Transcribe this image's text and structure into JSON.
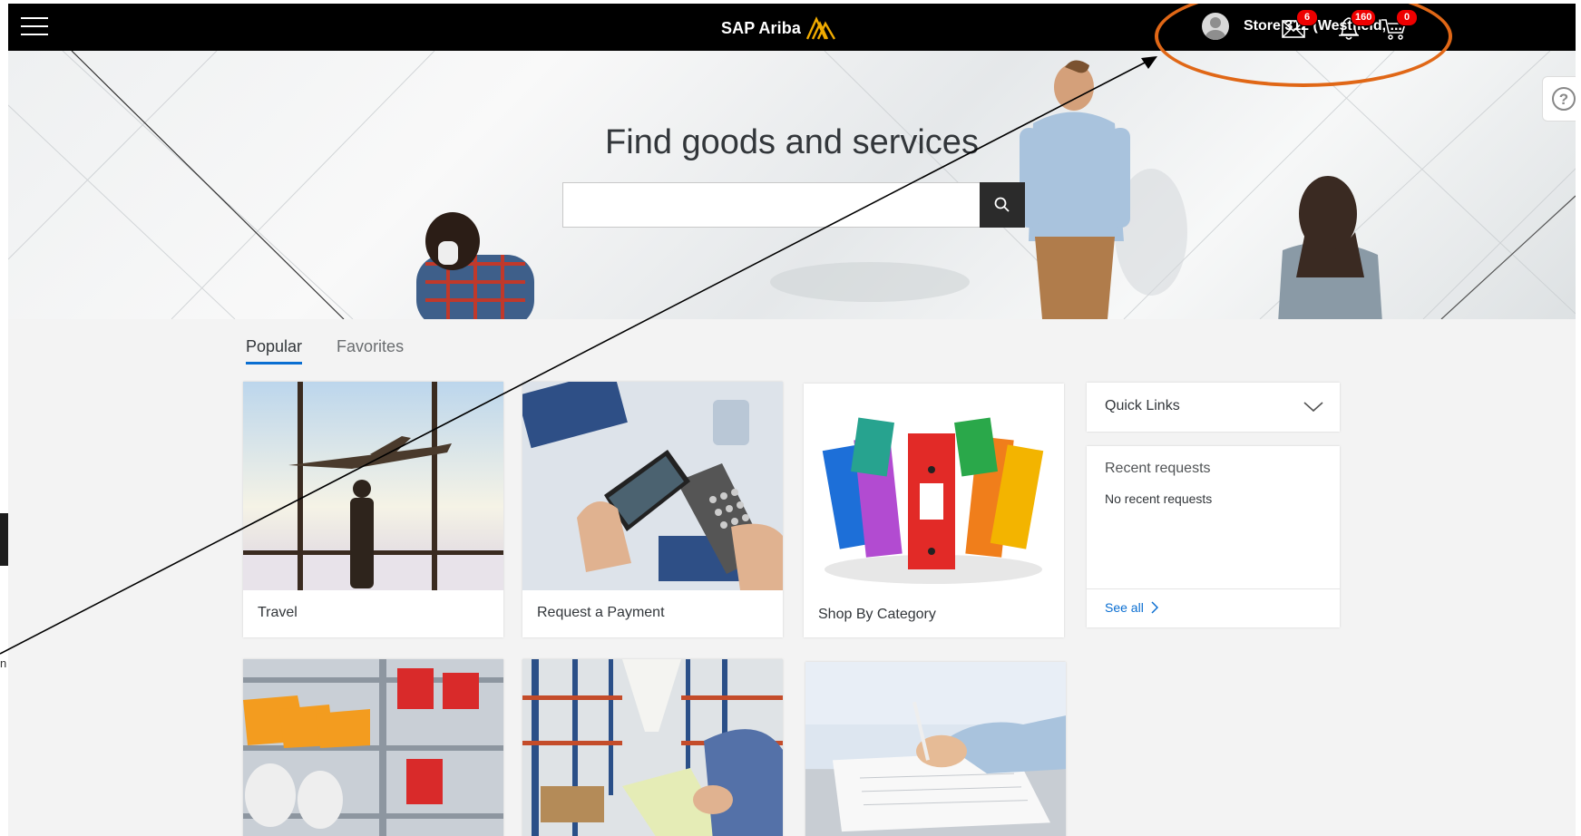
{
  "topbar": {
    "brand": "SAP Ariba",
    "user_name": "Store 312 (Westfield, ...",
    "messages_count": "6",
    "notifications_count": "160",
    "cart_count": "0"
  },
  "hero": {
    "title": "Find goods and services",
    "search_value": ""
  },
  "tabs": [
    {
      "label": "Popular",
      "active": true
    },
    {
      "label": "Favorites",
      "active": false
    }
  ],
  "tiles": [
    {
      "label": "Travel",
      "image": "airport-image"
    },
    {
      "label": "Request a Payment",
      "image": "payment-terminal-image"
    },
    {
      "label": "Shop By Category",
      "image": "binders-image"
    },
    {
      "label": "",
      "image": "supply-bins-image"
    },
    {
      "label": "",
      "image": "warehouse-image"
    },
    {
      "label": "",
      "image": "signing-document-image"
    }
  ],
  "quick_links": {
    "title": "Quick Links"
  },
  "recent_requests": {
    "title": "Recent requests",
    "empty_text": "No recent requests",
    "see_all": "See all"
  },
  "stray_text": "n",
  "colors": {
    "topbar": "#000000",
    "accent": "#0a6ed1",
    "annotation": "#e06716",
    "badge": "#ee0000",
    "brand_logo": "#f0ab00"
  }
}
